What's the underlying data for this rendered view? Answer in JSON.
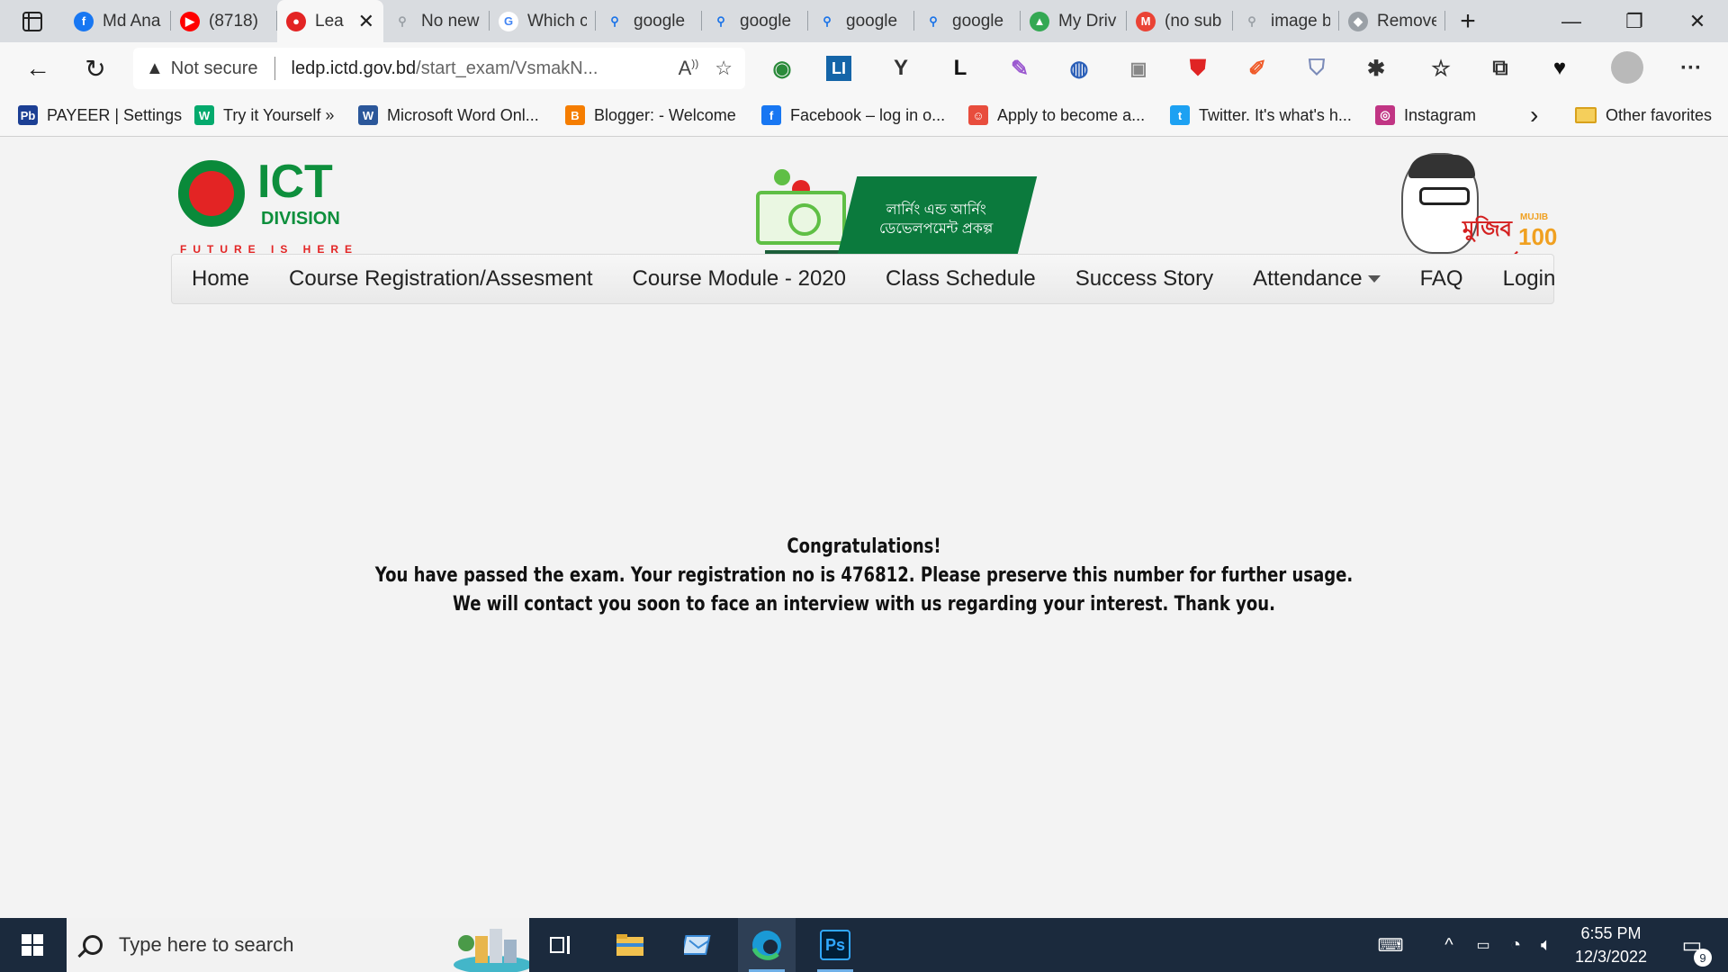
{
  "browser": {
    "tabs": [
      {
        "title": "Md Ana",
        "favicon": "facebook-icon",
        "color": "#1877f2",
        "glyph": "f"
      },
      {
        "title": "(8718)",
        "favicon": "youtube-icon",
        "color": "#ff0000",
        "glyph": "▶"
      },
      {
        "title": "Lea",
        "favicon": "ict-division-icon",
        "color": "#e32424",
        "glyph": "●",
        "active": true
      },
      {
        "title": "No new",
        "favicon": "search-icon",
        "color": "#9aa0a6",
        "glyph": "⚲"
      },
      {
        "title": "Which c",
        "favicon": "google-icon",
        "color": "#ffffff",
        "glyph": "G"
      },
      {
        "title": "google",
        "favicon": "search-icon",
        "color": "#1a73e8",
        "glyph": "⚲"
      },
      {
        "title": "google",
        "favicon": "search-icon",
        "color": "#1a73e8",
        "glyph": "⚲"
      },
      {
        "title": "google",
        "favicon": "search-icon",
        "color": "#1a73e8",
        "glyph": "⚲"
      },
      {
        "title": "google",
        "favicon": "search-icon",
        "color": "#1a73e8",
        "glyph": "⚲"
      },
      {
        "title": "My Driv",
        "favicon": "google-drive-icon",
        "color": "#34a853",
        "glyph": "▲"
      },
      {
        "title": "(no sub",
        "favicon": "gmail-icon",
        "color": "#ea4335",
        "glyph": "M"
      },
      {
        "title": "image b",
        "favicon": "search-icon",
        "color": "#9aa0a6",
        "glyph": "⚲"
      },
      {
        "title": "Remove",
        "favicon": "remove-icon",
        "color": "#9aa0a6",
        "glyph": "◆"
      }
    ],
    "close_tab_glyph": "✕",
    "new_tab_glyph": "+",
    "window_controls": {
      "minimize": "—",
      "maximize": "❐",
      "close": "✕"
    },
    "address": {
      "security_label": "Not secure",
      "url_host": "ledp.ictd.gov.bd",
      "url_path": "/start_exam/VsmakN..."
    },
    "toolbar_icons": [
      "globe-extension-icon",
      "linkedin-extension-icon",
      "y-extension-icon",
      "l-extension-icon",
      "pen-extension-icon",
      "circle-extension-icon",
      "camera-icon",
      "shield-red-icon",
      "color-picker-icon",
      "shield-icon",
      "extensions-puzzle-icon",
      "favorites-star-icon",
      "collections-icon",
      "heartbeat-icon",
      "profile-avatar-icon",
      "more-menu-icon"
    ],
    "favorites": [
      {
        "label": "PAYEER | Settings",
        "icon": "payeer-icon",
        "glyph": "Pb",
        "color": "#1c3f94"
      },
      {
        "label": "Try it Yourself »",
        "icon": "w3schools-icon",
        "glyph": "W",
        "color": "#04aa6d"
      },
      {
        "label": "Microsoft Word Onl...",
        "icon": "word-icon",
        "glyph": "W",
        "color": "#2b579a"
      },
      {
        "label": "Blogger: - Welcome",
        "icon": "blogger-icon",
        "glyph": "B",
        "color": "#f57d00"
      },
      {
        "label": "Facebook – log in o...",
        "icon": "facebook-icon",
        "glyph": "f",
        "color": "#1877f2"
      },
      {
        "label": "Apply to become a...",
        "icon": "apply-icon",
        "glyph": "☺",
        "color": "#e84d3d"
      },
      {
        "label": "Twitter. It's what's h...",
        "icon": "twitter-icon",
        "glyph": "t",
        "color": "#1da1f2"
      },
      {
        "label": "Instagram",
        "icon": "instagram-icon",
        "glyph": "◎",
        "color": "#c13584"
      }
    ],
    "favorites_more": "›",
    "other_favorites": "Other favorites"
  },
  "site": {
    "logo": {
      "title": "ICT",
      "subtitle": "DIVISION",
      "tagline": "FUTURE IS HERE"
    },
    "center_banner": {
      "line1": "লার্নিং এন্ড আর্নিং",
      "line2": "ডেভেলপমেন্ট প্রকল্প"
    },
    "mujib": {
      "text": "মুজিব শতবর্ষ",
      "small": "MUJIB",
      "number": "100"
    },
    "nav": [
      {
        "label": "Home"
      },
      {
        "label": "Course Registration/Assesment"
      },
      {
        "label": "Course Module - 2020"
      },
      {
        "label": "Class Schedule"
      },
      {
        "label": "Success Story"
      },
      {
        "label": "Attendance",
        "dropdown": true
      },
      {
        "label": "FAQ"
      },
      {
        "label": "Login"
      }
    ],
    "message": {
      "line1": "Congratulations!",
      "line2": "You have passed the exam. Your registration no is 476812. Please preserve this number for further usage.",
      "line3": "We will contact you soon to face an interview with us regarding your interest. Thank you."
    }
  },
  "taskbar": {
    "search_placeholder": "Type here to search",
    "apps": [
      "task-view-icon",
      "file-explorer-icon",
      "mail-app-icon",
      "edge-icon",
      "photoshop-icon"
    ],
    "photoshop_label": "Ps",
    "clock": {
      "time": "6:55 PM",
      "date": "12/3/2022"
    },
    "notifications_count": "9"
  }
}
